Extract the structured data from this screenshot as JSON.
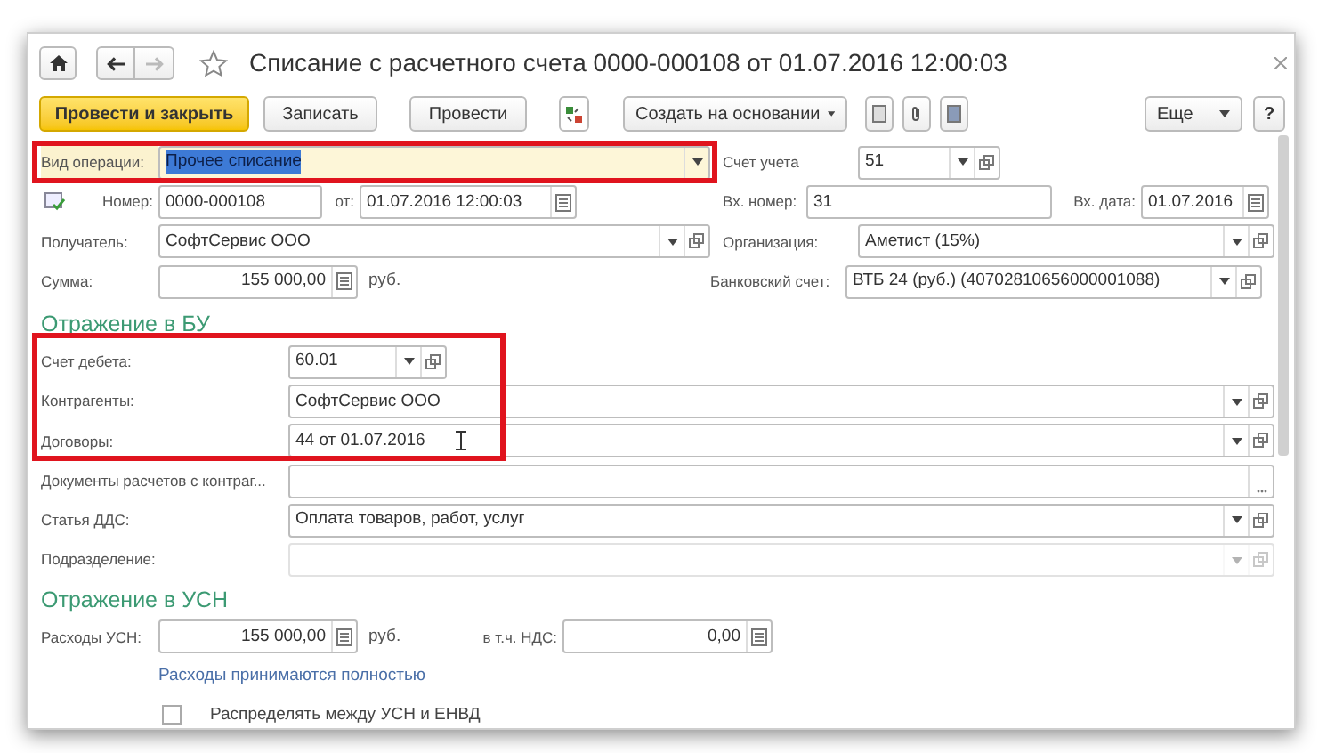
{
  "window": {
    "title": "Списание с расчетного счета 0000-000108 от 01.07.2016 12:00:03"
  },
  "toolbar": [
    {
      "kind": "primary",
      "label": "Провести и закрыть"
    },
    {
      "kind": "button",
      "label": "Записать"
    },
    {
      "kind": "button",
      "label": "Провести"
    },
    {
      "kind": "dropdown",
      "label": "Создать на основании"
    }
  ],
  "toolbar_right": [
    {
      "kind": "dropdown",
      "label": "Еще"
    },
    {
      "kind": "button",
      "label": "?"
    }
  ],
  "operation": {
    "label": "Вид операции:",
    "value": "Прочее списание",
    "text_selected": true,
    "highlighted": true
  },
  "account": {
    "label": "Счет учета",
    "value": "51"
  },
  "number": {
    "label": "Номер:",
    "value": "0000-000108"
  },
  "date": {
    "label": "от:",
    "value": "01.07.2016 12:00:03"
  },
  "in_number": {
    "label": "Вх. номер:",
    "value": "31"
  },
  "in_date": {
    "label": "Вх. дата:",
    "value": "01.07.2016"
  },
  "recipient": {
    "label": "Получатель:",
    "value": "СофтСервис ООО"
  },
  "organization": {
    "label": "Организация:",
    "value": "Аметист (15%)"
  },
  "sum": {
    "label": "Сумма:",
    "value": "155 000,00",
    "unit": "руб."
  },
  "bank_account": {
    "label": "Банковский счет:",
    "value": "ВТБ 24 (руб.) (40702810656000001088)"
  },
  "bu_section": {
    "title": "Отражение в БУ",
    "highlighted": true,
    "fields": [
      {
        "kind": "short",
        "label": "Счет дебета:",
        "value": "60.01",
        "disabled": false
      },
      {
        "kind": "select",
        "label": "Контрагенты:",
        "value": "СофтСервис ООО",
        "disabled": false
      },
      {
        "kind": "select",
        "label": "Договоры:",
        "value": "44 от 01.07.2016",
        "disabled": false
      },
      {
        "kind": "choice",
        "label": "Документы расчетов с контраг...",
        "disabled": false
      },
      {
        "kind": "select",
        "label": "Статья ДДС:",
        "value": "Оплата товаров, работ, услуг",
        "disabled": false
      },
      {
        "kind": "select",
        "label": "Подразделение:",
        "disabled": true
      }
    ]
  },
  "usn_section": {
    "title": "Отражение в УСН",
    "expenses": {
      "label": "Расходы УСН:",
      "value": "155 000,00",
      "unit": "руб."
    },
    "vat": {
      "label": "в т.ч. НДС:",
      "value": "0,00"
    },
    "link": "Расходы принимаются полностью",
    "checkbox": {
      "label": "Распределять между УСН и ЕНВД",
      "checked": false
    }
  }
}
